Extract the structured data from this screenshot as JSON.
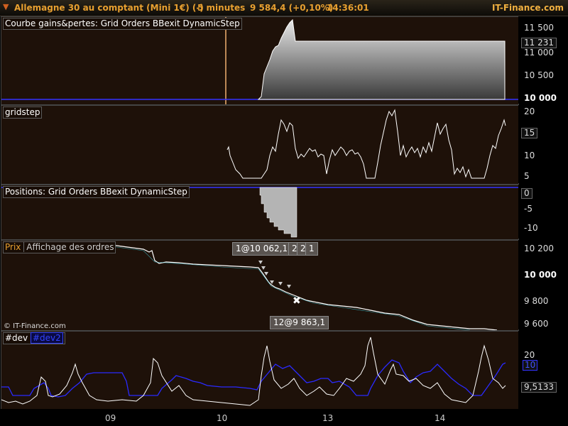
{
  "header": {
    "arrow": "▼",
    "instrument": "Allemagne 30 au comptant (Mini 1€) (-)",
    "timeframe": "5 minutes",
    "price": "9 584,4 (+0,10%)",
    "time": "14:36:01",
    "brand": "IT-Finance.com"
  },
  "panels": {
    "equity": {
      "label": "Courbe gains&pertes: Grid Orders BBexit DynamicStep",
      "ticks": [
        "11 500",
        "11 231",
        "11 000",
        "10 500",
        "10 000"
      ]
    },
    "gridstep": {
      "label": "gridstep",
      "ticks": [
        "20",
        "15",
        "10",
        "5"
      ]
    },
    "positions": {
      "label": "Positions: Grid Orders BBexit DynamicStep",
      "ticks": [
        "0",
        "-5",
        "-10"
      ]
    },
    "price": {
      "label": "Prix",
      "sublabel": "Affichage des ordres",
      "ticks": [
        "10 200",
        "10 000",
        "9 800",
        "9 600"
      ],
      "copyright": "© IT-Finance.com",
      "tooltips": [
        "1@10 062,1",
        "2",
        "2",
        "1",
        "12@9 863,1"
      ]
    },
    "dev": {
      "label": "#dev",
      "label2": "#dev2",
      "ticks": [
        "20",
        "10",
        "9,5133"
      ]
    }
  },
  "xaxis": [
    "09",
    "10",
    "13",
    "14"
  ],
  "colors": {
    "title": "#e8a030",
    "panel_bg": "#1e1109",
    "blue": "#2020ff",
    "equity_fill": "#cccccc"
  }
}
